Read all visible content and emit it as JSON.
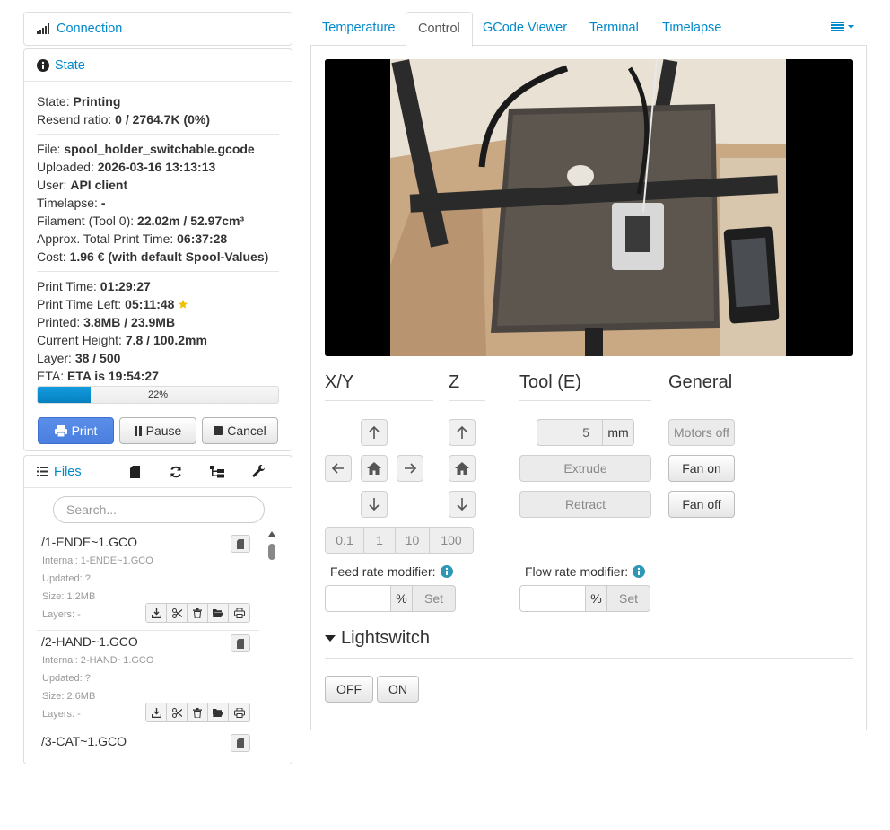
{
  "sidebar": {
    "connection": {
      "title": "Connection"
    },
    "state": {
      "title": "State",
      "rows": {
        "state": {
          "label": "State:",
          "value": "Printing"
        },
        "resend": {
          "label": "Resend ratio:",
          "value": "0 / 2764.7K (0%)"
        },
        "file": {
          "label": "File:",
          "value": "spool_holder_switchable.gcode"
        },
        "uploaded": {
          "label": "Uploaded:",
          "value": "2026-03-16 13:13:13"
        },
        "user": {
          "label": "User:",
          "value": "API client"
        },
        "timelapse": {
          "label": "Timelapse:",
          "value": "-"
        },
        "filament": {
          "label": "Filament (Tool 0):",
          "value": "22.02m / 52.97cm³"
        },
        "approx": {
          "label": "Approx. Total Print Time:",
          "value": "06:37:28"
        },
        "cost": {
          "label": "Cost:",
          "value": "1.96 € (with default Spool-Values)"
        },
        "print_time": {
          "label": "Print Time:",
          "value": "01:29:27"
        },
        "time_left": {
          "label": "Print Time Left:",
          "value": "05:11:48"
        },
        "printed": {
          "label": "Printed:",
          "value": "3.8MB / 23.9MB"
        },
        "height": {
          "label": "Current Height:",
          "value": "7.8 / 100.2mm"
        },
        "layer": {
          "label": "Layer:",
          "value": "38 / 500"
        },
        "eta": {
          "label": "ETA:",
          "value": "ETA is 19:54:27"
        }
      },
      "progress": {
        "percent": 22,
        "text": "22%"
      },
      "buttons": {
        "print": "Print",
        "pause": "Pause",
        "cancel": "Cancel"
      }
    },
    "files": {
      "title": "Files",
      "search_placeholder": "Search...",
      "items": [
        {
          "name": "/1-ENDE~1.GCO",
          "internal": "Internal: 1-ENDE~1.GCO",
          "updated": "Updated: ?",
          "size": "Size: 1.2MB",
          "layers": "Layers: -"
        },
        {
          "name": "/2-HAND~1.GCO",
          "internal": "Internal: 2-HAND~1.GCO",
          "updated": "Updated: ?",
          "size": "Size: 2.6MB",
          "layers": "Layers: -"
        },
        {
          "name": "/3-CAT~1.GCO"
        }
      ]
    }
  },
  "tabs": [
    "Temperature",
    "Control",
    "GCode Viewer",
    "Terminal",
    "Timelapse"
  ],
  "active_tab": "Control",
  "control": {
    "xy_title": "X/Y",
    "z_title": "Z",
    "tool_title": "Tool (E)",
    "general_title": "General",
    "steps": [
      "0.1",
      "1",
      "10",
      "100"
    ],
    "tool_amount": "5",
    "tool_unit": "mm",
    "extrude": "Extrude",
    "retract": "Retract",
    "motors_off": "Motors off",
    "fan_on": "Fan on",
    "fan_off": "Fan off",
    "feed_label": "Feed rate modifier:",
    "flow_label": "Flow rate modifier:",
    "percent": "%",
    "set": "Set",
    "lightswitch": {
      "title": "Lightswitch",
      "off": "OFF",
      "on": "ON"
    }
  },
  "colors": {
    "link": "#0088cc",
    "primary_button": "#4a7fe0",
    "progress": "#0480be",
    "star": "#f0c000"
  }
}
